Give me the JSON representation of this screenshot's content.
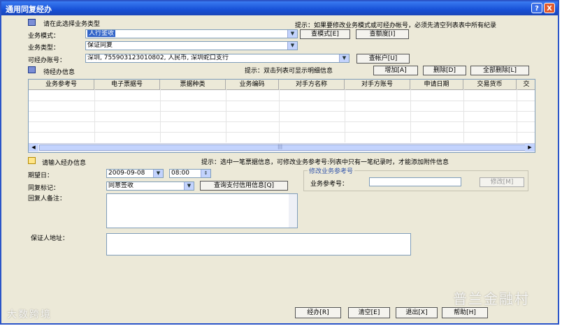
{
  "window": {
    "title": "通用同复经办",
    "help_glyph": "?",
    "close_glyph": "X"
  },
  "top_section": {
    "header": "请在此选择业务类型",
    "hint": "提示：如果要修改业务模式或可经办帐号，必须先清空列表表中所有纪录",
    "mode_label": "业务模式：",
    "mode_value": "人行鉴收",
    "type_label": "业务类型：",
    "type_value": "保证同复",
    "account_label": "可经办账号：",
    "account_value": "深圳, 755903123010802, 人民币, 深圳蛇口支行",
    "btn_query_mode": "查模式[E]",
    "btn_query_quota": "查额度[I]",
    "btn_query_account": "查帐户[U]"
  },
  "list_section": {
    "header": "待经办信息",
    "hint": "提示：双击列表可显示明细信息",
    "btn_add": "增加[A]",
    "btn_delete": "删除[D]",
    "btn_delete_all": "全部删除[L]",
    "columns": [
      "业务参考号",
      "电子票据号",
      "票据种类",
      "业务编码",
      "对手方名称",
      "对手方账号",
      "申请日期",
      "交易货币",
      "交"
    ],
    "scroll_label": "|||"
  },
  "input_section": {
    "header": "请输入经办信息",
    "hint": "提示：选中一笔票据信息，可修改业务参考号:列表中只有一笔纪录时，才能添加附件信息",
    "due_label": "期望日：",
    "due_date": "2009-09-08",
    "due_time": "08:00",
    "reply_label": "同复标记：",
    "reply_value": "同意签收",
    "btn_query_credit": "查询支付信用信息[Q]",
    "remark_label": "回复人备注：",
    "guarantor_label": "保证人地址：",
    "modify_group_title": "修改业务参考号",
    "ref_label": "业务参考号：",
    "ref_value": "",
    "btn_modify": "修改[M]"
  },
  "footer": {
    "btn_process": "经办[R]",
    "btn_clear": "清空[E]",
    "btn_exit": "退出[X]",
    "btn_help": "帮助[H]"
  },
  "watermarks": {
    "left": "大数跨境",
    "right": "普兰金融村"
  }
}
